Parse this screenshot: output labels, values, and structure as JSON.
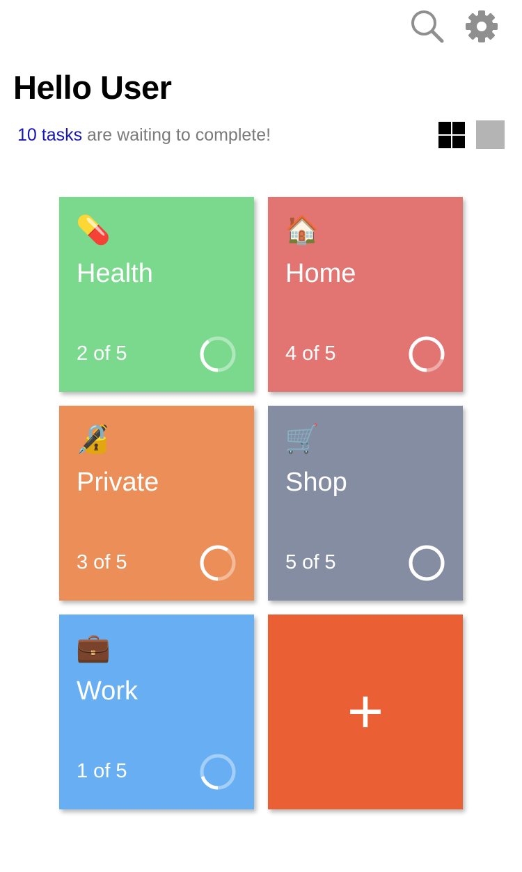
{
  "header": {
    "greeting": "Hello User",
    "tasks_link": "10 tasks",
    "tasks_suffix": " are waiting to complete!"
  },
  "icons": {
    "search": "search-icon",
    "settings": "gear-icon",
    "view_grid": "grid-view-icon",
    "view_single": "single-view-icon"
  },
  "categories": [
    {
      "emoji": "💊",
      "name": "Health",
      "progress_label": "2 of 5",
      "done": 2,
      "total": 5,
      "color": "#7ad98c"
    },
    {
      "emoji": "🏠",
      "name": "Home",
      "progress_label": "4 of 5",
      "done": 4,
      "total": 5,
      "color": "#e27572"
    },
    {
      "emoji": "🔏",
      "name": "Private",
      "progress_label": "3 of 5",
      "done": 3,
      "total": 5,
      "color": "#eb8e57"
    },
    {
      "emoji": "🛒",
      "name": "Shop",
      "progress_label": "5 of 5",
      "done": 5,
      "total": 5,
      "color": "#858da3"
    },
    {
      "emoji": "💼",
      "name": "Work",
      "progress_label": "1 of 5",
      "done": 1,
      "total": 5,
      "color": "#67aef3"
    }
  ],
  "add_tile": {
    "symbol": "+",
    "color": "#ea5f34"
  }
}
